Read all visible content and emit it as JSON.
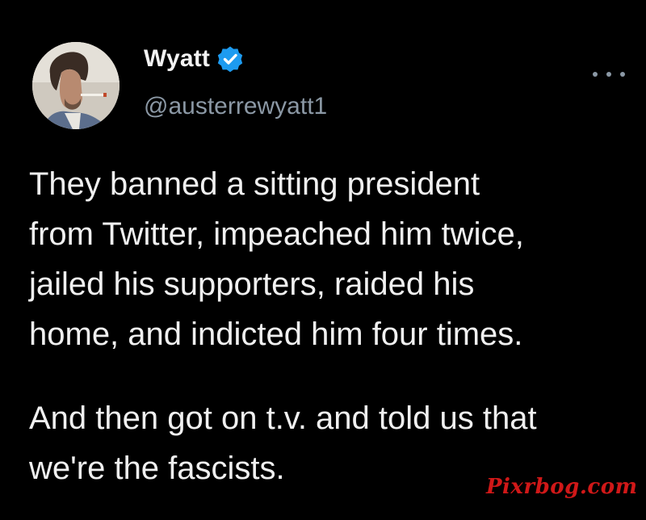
{
  "tweet": {
    "author": {
      "display_name": "Wyatt",
      "handle": "@austerrewyatt1",
      "verified": true
    },
    "menu_icon": "more-horizontal-icon",
    "text_lines": [
      "They banned a sitting president",
      "from Twitter, impeached him twice,",
      "jailed his supporters, raided his",
      "home, and indicted him four times."
    ],
    "text_lines_2": [
      "And then got on t.v. and told us that",
      "we're the fascists."
    ]
  },
  "watermark": {
    "text": "Pixrbog.com"
  },
  "colors": {
    "background": "#000000",
    "text": "#f0f0f0",
    "handle": "#8b98a5",
    "verified": "#1d9bf0",
    "watermark": "#d01818"
  }
}
